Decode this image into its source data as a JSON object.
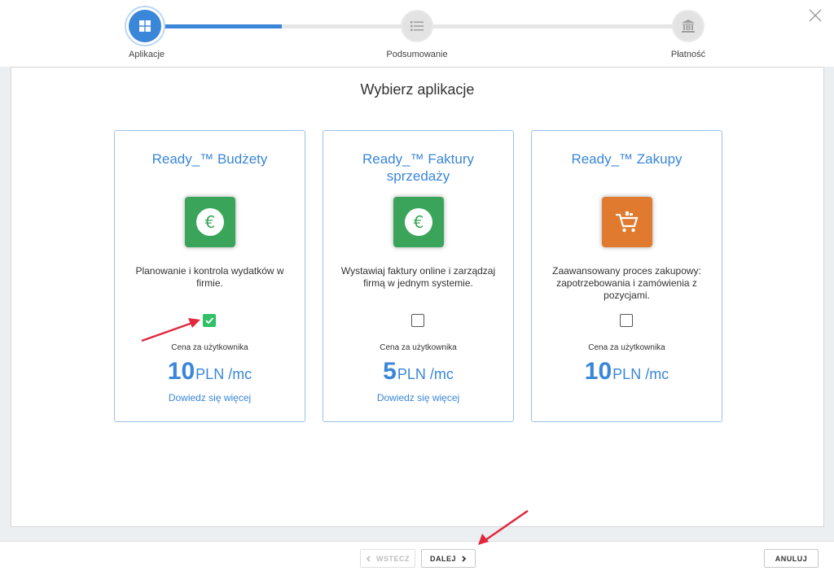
{
  "wizard": {
    "steps": [
      {
        "label": "Aplikacje",
        "state": "active",
        "icon": "windows-grid-icon"
      },
      {
        "label": "Podsumowanie",
        "state": "pending",
        "icon": "list-icon"
      },
      {
        "label": "Płatność",
        "state": "pending",
        "icon": "bank-icon"
      }
    ],
    "progress_fraction": 0.25
  },
  "main": {
    "heading": "Wybierz aplikacje",
    "cards": [
      {
        "title": "Ready_™ Budżety",
        "icon": "euro-icon",
        "icon_color": "#3aa55a",
        "description": "Planowanie i kontrola wydatków w firmie.",
        "checked": true,
        "price_label": "Cena za użytkownika",
        "price_value": "10",
        "price_unit": "PLN /mc",
        "learn_more": "Dowiedz się więcej"
      },
      {
        "title": "Ready_™ Faktury sprzedaży",
        "icon": "euro-icon",
        "icon_color": "#3aa55a",
        "description": "Wystawiaj faktury online i zarządzaj firmą w jednym systemie.",
        "checked": false,
        "price_label": "Cena za użytkownika",
        "price_value": "5",
        "price_unit": "PLN /mc",
        "learn_more": "Dowiedz się więcej"
      },
      {
        "title": "Ready_™ Zakupy",
        "icon": "shopping-cart-icon",
        "icon_color": "#e07a2f",
        "description": "Zaawansowany proces zakupowy: zapotrzebowania i zamówienia z pozycjami.",
        "checked": false,
        "price_label": "Cena za użytkownika",
        "price_value": "10",
        "price_unit": "PLN /mc",
        "learn_more": ""
      }
    ]
  },
  "footer": {
    "back_label": "WSTECZ",
    "next_label": "DALEJ",
    "cancel_label": "ANULUJ"
  },
  "colors": {
    "accent": "#3a86d8",
    "check_green": "#2ec165",
    "annotation_red": "#e0283d"
  }
}
